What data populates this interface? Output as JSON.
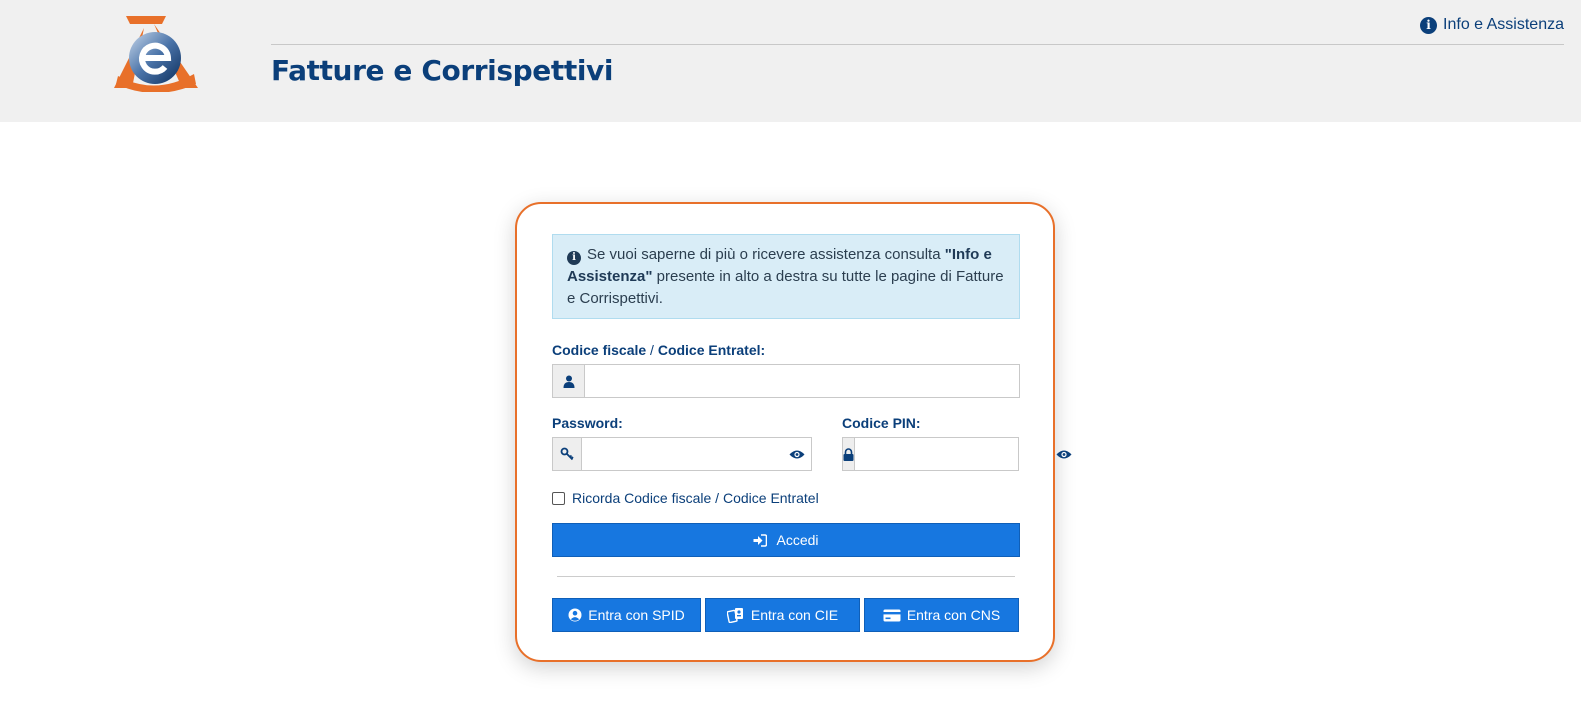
{
  "header": {
    "app_title": "Fatture e Corrispettivi",
    "info_link": "Info e Assistenza"
  },
  "alert": {
    "text_before": "Se vuoi saperne di più o ricevere assistenza consulta ",
    "bold_text": "\"Info e Assistenza\"",
    "text_after": " presente in alto a destra su tutte le pagine di Fatture e Corrispettivi."
  },
  "form": {
    "cf_label_a": "Codice fiscale",
    "cf_label_sep": " / ",
    "cf_label_b": "Codice Entratel:",
    "cf_value": "",
    "password_label": "Password:",
    "password_value": "",
    "pin_label": "Codice PIN:",
    "pin_value": "",
    "remember_a": "Ricorda Codice fiscale",
    "remember_sep": " / ",
    "remember_b": "Codice Entratel",
    "login_label": "Accedi"
  },
  "alt_login": [
    {
      "label": "Entra con SPID",
      "icon": "user-circle-icon"
    },
    {
      "label": "Entra con CIE",
      "icon": "id-card-icon"
    },
    {
      "label": "Entra con CNS",
      "icon": "credit-card-icon"
    }
  ],
  "colors": {
    "brand_blue": "#0b3f7a",
    "button_blue": "#1777e0",
    "card_border": "#e8702a",
    "alert_bg": "#d9edf7",
    "logo_orange": "#e8702a"
  }
}
